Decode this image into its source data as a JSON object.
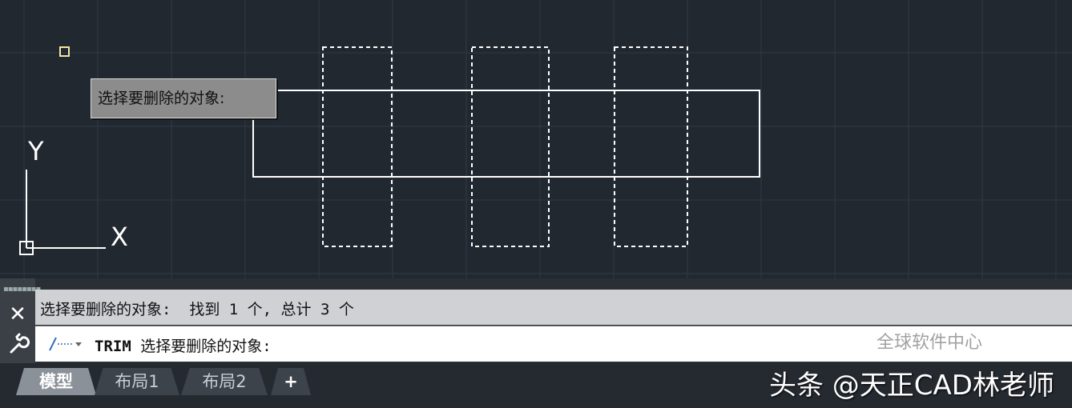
{
  "canvas": {
    "tooltip_text": "选择要删除的对象:",
    "ucs_x_label": "X",
    "ucs_y_label": "Y"
  },
  "command": {
    "history_text": "选择要删除的对象:  找到 1 个, 总计 3 个",
    "command_name": "TRIM",
    "prompt_text": " 选择要删除的对象:",
    "close_icon": "close-icon",
    "wrench_icon": "wrench-icon"
  },
  "tabs": [
    {
      "label": "模型",
      "active": true
    },
    {
      "label": "布局1",
      "active": false
    },
    {
      "label": "布局2",
      "active": false
    },
    {
      "label": "+",
      "active": false
    }
  ],
  "watermark": {
    "small": "全球软件中心",
    "big": "头条 @天正CAD林老师"
  },
  "colors": {
    "canvas_bg": "#212830",
    "grid": "#2f3a47",
    "geometry": "#ffffff"
  }
}
